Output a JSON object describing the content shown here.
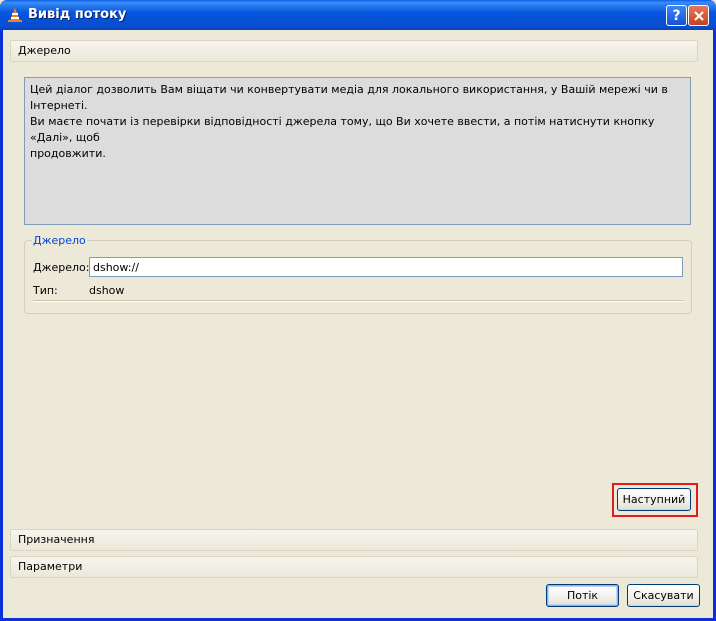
{
  "window": {
    "title": "Вивід потоку"
  },
  "sections": {
    "source_header": "Джерело",
    "destination_header": "Призначення",
    "options_header": "Параметри"
  },
  "info": {
    "line1": "Цей діалог дозволить Вам віщати чи конвертувати медіа для локального використання, у Вашій мережі чи в Інтернеті.",
    "line2": "Ви маєте почати із перевірки відповідності джерела тому, що Ви хочете ввести, а потім натиснути кнопку «Далі», щоб",
    "line3": "продовжити."
  },
  "source_group": {
    "title": "Джерело",
    "source_label": "Джерело:",
    "source_value": "dshow://",
    "type_label": "Тип:",
    "type_value": "dshow"
  },
  "buttons": {
    "next": "Наступний",
    "stream": "Потік",
    "cancel": "Скасувати"
  },
  "colors": {
    "titlebar": "#0b58e0",
    "highlight": "#e01c1c",
    "group_title": "#0046d5"
  }
}
